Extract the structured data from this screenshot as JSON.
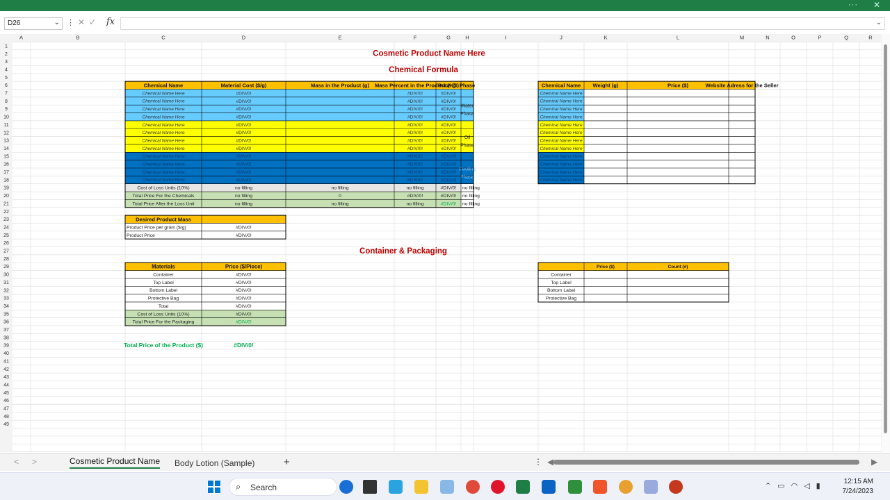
{
  "formula_bar": {
    "name_box": "D26",
    "fx_label": "fx",
    "formula": ""
  },
  "columns": [
    "A",
    "B",
    "C",
    "D",
    "E",
    "F",
    "G",
    "H",
    "I",
    "J",
    "K",
    "L",
    "M",
    "N",
    "O",
    "P",
    "Q",
    "R"
  ],
  "title": "Cosmetic Product Name Here",
  "section_chemical": "Chemical Formula",
  "chem_headers": [
    "Chemical Name",
    "Material Cost ($/g)",
    "Mass in the Product (g)",
    "Mass Percent in the Product (%)",
    "Price ($)",
    "Phase"
  ],
  "chem_row_label": "Chemical Name Here",
  "div_error": "#DIV/0!",
  "phases": {
    "water": [
      "Water",
      "Phase"
    ],
    "oil": [
      "Oil",
      "Phase"
    ],
    "cooling": [
      "Cooling",
      "Phase"
    ]
  },
  "summary_rows": [
    {
      "label": "Cost of Loss Units (10%)",
      "c": "no filling",
      "d": "no filling",
      "e": "no filling",
      "f": "#DIV/0!",
      "g": "no filling"
    },
    {
      "label": "Total Price For the Chemicals",
      "c": "no filling",
      "d": "0",
      "e": "#DIV/0!",
      "f": "#DIV/0!",
      "g": "no filling"
    },
    {
      "label": "Total Price After the Loss Unit",
      "c": "no filling",
      "d": "no filling",
      "e": "no filling",
      "f": "#DIV/0!",
      "g": "no filling"
    }
  ],
  "seller_headers": [
    "Chemical Name",
    "Weight (g)",
    "Price ($)",
    "Website Adress for the Seller"
  ],
  "desired": {
    "header": "Desired Product Mass",
    "rows": [
      "Product Price per gram ($/g)",
      "Product Price"
    ],
    "value": "#DIV/0!"
  },
  "section_container": "Container & Packaging",
  "materials_headers": [
    "Materials",
    "Price  ($/Piece)"
  ],
  "materials_rows": [
    "Container",
    "Top Label",
    "Bottom Label",
    "Protective Bag",
    "Total",
    "Cost of Loss Units (10%)",
    "Total Price For the Packaging"
  ],
  "pack_headers": [
    "",
    "Price ($)",
    "Count (#)"
  ],
  "pack_rows": [
    "Container",
    "Top Label",
    "Bottom Label",
    "Protective Bag"
  ],
  "total_label": "Total Price of the Product ($)",
  "total_value": "#DIV/0!",
  "tabs": [
    "Cosmetic Product Name",
    "Body Lotion (Sample)"
  ],
  "add_sheet": "+",
  "taskbar": {
    "search": "Search",
    "time": "12:15 AM",
    "date": "7/24/2023"
  },
  "colors": {
    "orange": "#ffc000",
    "light_blue": "#66ccff",
    "yellow": "#ffff00",
    "dark_blue": "#0070c0",
    "green_fill": "#c6e0b4",
    "gray_fill": "#e7e6e6",
    "red_title": "#c00000",
    "green_text": "#00b050",
    "excel_green": "#1e7e45"
  }
}
